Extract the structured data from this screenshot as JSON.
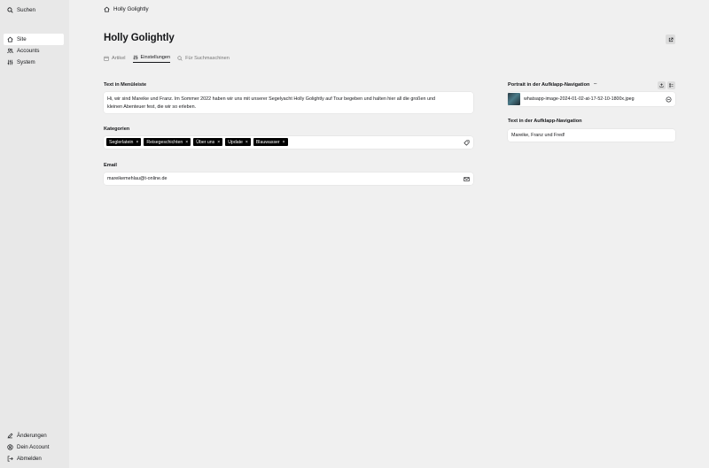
{
  "sidebar": {
    "search_label": "Suchen",
    "nav": [
      {
        "label": "Site",
        "icon": "home-icon",
        "active": true
      },
      {
        "label": "Accounts",
        "icon": "users-icon",
        "active": false
      },
      {
        "label": "System",
        "icon": "sliders-icon",
        "active": false
      }
    ],
    "bottom": [
      {
        "label": "Änderungen",
        "icon": "pencil-icon"
      },
      {
        "label": "Dein Account",
        "icon": "account-icon"
      },
      {
        "label": "Abmelden",
        "icon": "logout-icon"
      }
    ]
  },
  "breadcrumb": {
    "label": "Holly Golightly"
  },
  "page": {
    "title": "Holly Golightly"
  },
  "tabs": [
    {
      "label": "Artikel",
      "active": false
    },
    {
      "label": "Einstellungen",
      "active": true
    },
    {
      "label": "Für Suchmaschinen",
      "active": false
    }
  ],
  "form": {
    "menu_text": {
      "label": "Text in Menüleiste",
      "value_line1": "Hi, wir sind Mareike und Franz. Im Sommer 2022 haben wir uns mit unserer Segelyacht Holly Golightly auf Tour begeben und halten hier all die großen und",
      "value_line2": "kleinen Abenteuer fest, die wir so erleben."
    },
    "categories": {
      "label": "Kategorien",
      "tags": [
        "Seglerlatein",
        "Reisegeschichten",
        "Über uns",
        "Update",
        "Blauwasser"
      ]
    },
    "email": {
      "label": "Email",
      "value": "mareikemehlau@t-online.de"
    },
    "portrait": {
      "label": "Portrait in der Aufklapp-Navigation",
      "filename": "whatsapp-image-2024-01-02-at-17-52-10-1800x.jpeg"
    },
    "nav_text": {
      "label": "Text in der Aufklapp-Navigation",
      "value": "Mareike, Franz und Fred!"
    }
  }
}
